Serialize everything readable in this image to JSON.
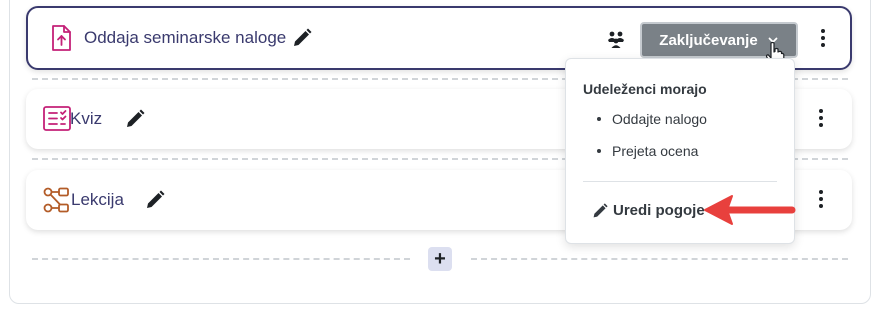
{
  "activities": [
    {
      "title": "Oddaja seminarske naloge",
      "icon": "assignment-icon",
      "accent": "#c42178"
    },
    {
      "title": "Kviz",
      "icon": "quiz-icon",
      "accent": "#c42178"
    },
    {
      "title": "Lekcija",
      "icon": "lesson-icon",
      "accent": "#b35c28"
    }
  ],
  "completion": {
    "button_label": "Zaključevanje",
    "dropdown": {
      "heading": "Udeleženci morajo",
      "conditions": [
        "Oddajte nalogo",
        "Prejeta ocena"
      ],
      "edit_label": "Uredi pogoje"
    }
  },
  "add_button_label": "+",
  "colors": {
    "title": "#3a3a6e",
    "button_bg": "#7a8187",
    "arrow": "#e8403d"
  }
}
